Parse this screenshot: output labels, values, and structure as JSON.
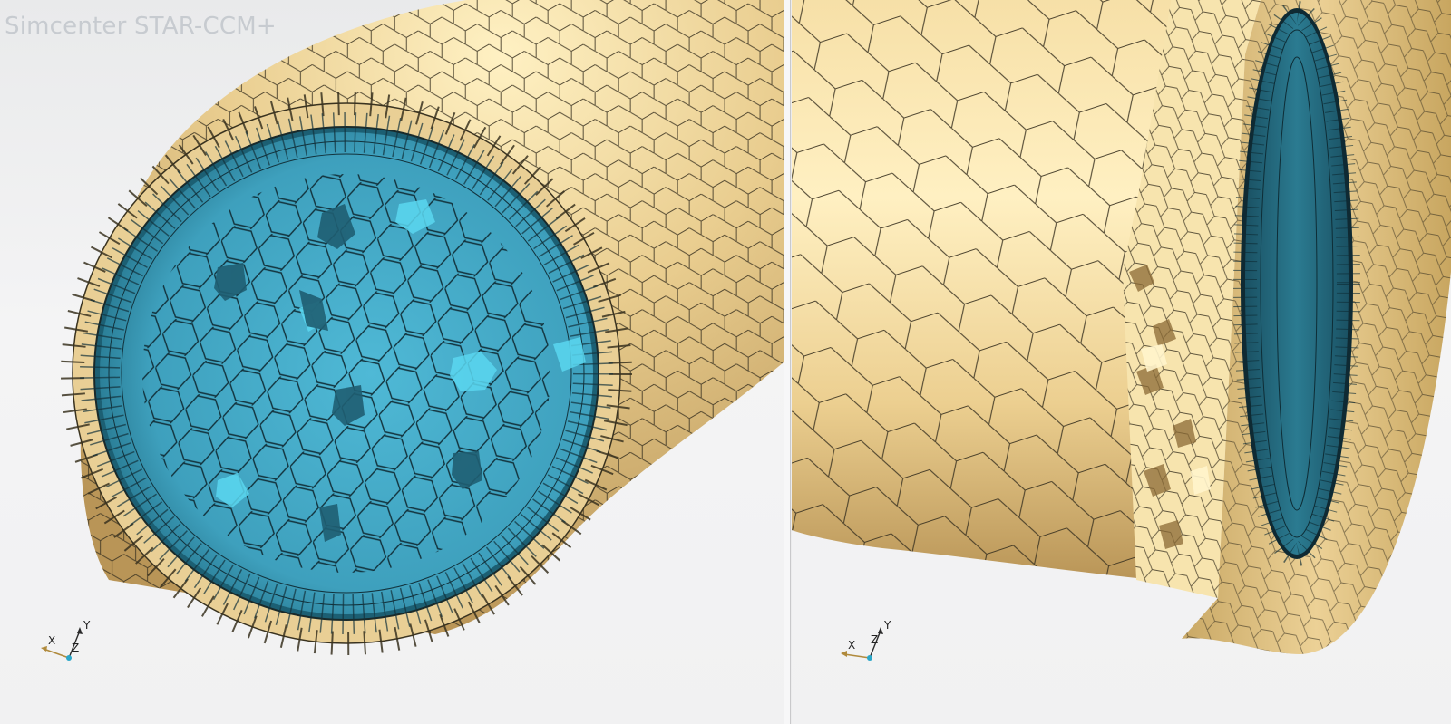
{
  "app": {
    "title": "Simcenter STAR-CCM+"
  },
  "viewports": [
    {
      "id": "left",
      "content": "mesh-pipe-cross-section",
      "axes": {
        "x": "X",
        "y": "Y",
        "z": "Z"
      }
    },
    {
      "id": "right",
      "content": "mesh-pipe-side-cut",
      "axes": {
        "x": "X",
        "y": "Y",
        "z": "Z"
      }
    }
  ],
  "colors": {
    "solid_mesh": "#e5c98c",
    "solid_mesh_highlight": "#fbe8b6",
    "fluid_mesh": "#3fa6c4",
    "fluid_mesh_dark": "#1e6f86",
    "mesh_edges": "#3a3320",
    "axis_x": "#b08a3c",
    "axis_y": "#2a2a2a",
    "axis_origin": "#2aa7c9"
  }
}
